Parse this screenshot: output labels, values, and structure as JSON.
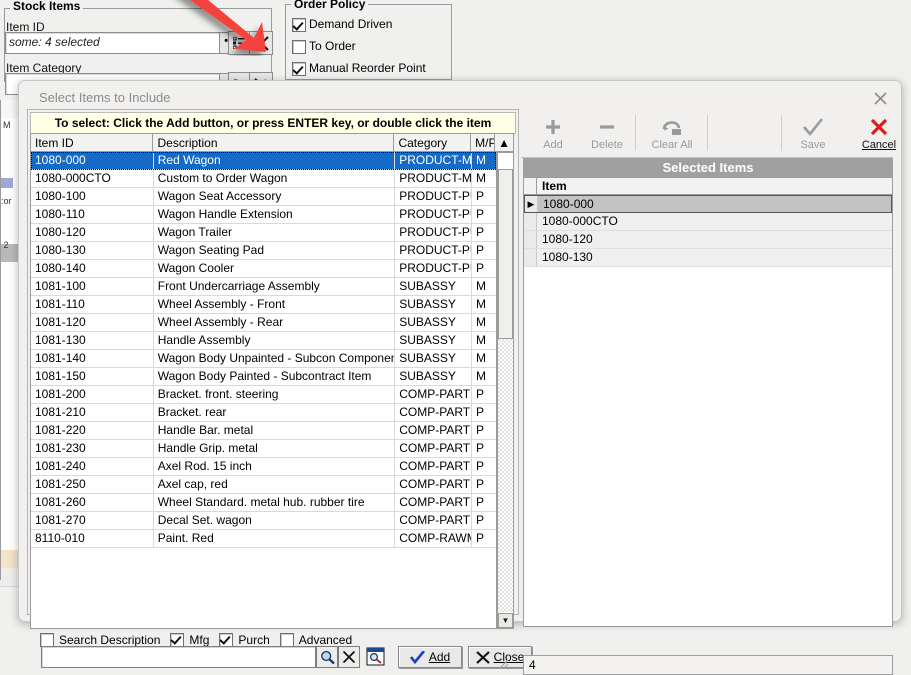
{
  "background": {
    "stock_items_group": "Stock Items",
    "item_id_label": "Item ID",
    "item_id_value": "some: 4 selected",
    "item_category_label": "Item Category",
    "order_policy_group": "Order Policy",
    "order_policy_options": [
      {
        "label": "Demand Driven",
        "checked": true
      },
      {
        "label": "To Order",
        "checked": false
      },
      {
        "label": "Manual Reorder Point",
        "checked": true
      }
    ],
    "lookup_icon": "list-lookup-icon",
    "clear_icon": "clear-x-icon",
    "ellipsis_icon": "ellipsis-icon"
  },
  "dialog": {
    "title": "Select Items to Include",
    "close_icon": "close-icon",
    "hint": "To select: Click the Add button, or press ENTER key, or double click the item",
    "grid": {
      "columns": [
        "Item ID",
        "Description",
        "Category",
        "M/P"
      ],
      "rows": [
        {
          "id": "1080-000",
          "desc": "Red Wagon",
          "cat": "PRODUCT-MFG",
          "mp": "M",
          "selected": true
        },
        {
          "id": "1080-000CTO",
          "desc": "Custom to Order Wagon",
          "cat": "PRODUCT-MFG",
          "mp": "M",
          "selected": false
        },
        {
          "id": "1080-100",
          "desc": "Wagon Seat Accessory",
          "cat": "PRODUCT-PURC",
          "mp": "P",
          "selected": false
        },
        {
          "id": "1080-110",
          "desc": "Wagon Handle Extension",
          "cat": "PRODUCT-PURC",
          "mp": "P",
          "selected": false
        },
        {
          "id": "1080-120",
          "desc": "Wagon Trailer",
          "cat": "PRODUCT-PURC",
          "mp": "P",
          "selected": false
        },
        {
          "id": "1080-130",
          "desc": "Wagon Seating Pad",
          "cat": "PRODUCT-PURC",
          "mp": "P",
          "selected": false
        },
        {
          "id": "1080-140",
          "desc": "Wagon Cooler",
          "cat": "PRODUCT-PURC",
          "mp": "P",
          "selected": false
        },
        {
          "id": "1081-100",
          "desc": "Front Undercarriage Assembly",
          "cat": "SUBASSY",
          "mp": "M",
          "selected": false
        },
        {
          "id": "1081-110",
          "desc": "Wheel Assembly - Front",
          "cat": "SUBASSY",
          "mp": "M",
          "selected": false
        },
        {
          "id": "1081-120",
          "desc": "Wheel Assembly - Rear",
          "cat": "SUBASSY",
          "mp": "M",
          "selected": false
        },
        {
          "id": "1081-130",
          "desc": "Handle Assembly",
          "cat": "SUBASSY",
          "mp": "M",
          "selected": false
        },
        {
          "id": "1081-140",
          "desc": "Wagon Body Unpainted - Subcon Component",
          "cat": "SUBASSY",
          "mp": "M",
          "selected": false
        },
        {
          "id": "1081-150",
          "desc": "Wagon Body Painted -  Subcontract Item",
          "cat": "SUBASSY",
          "mp": "M",
          "selected": false
        },
        {
          "id": "1081-200",
          "desc": "Bracket. front. steering",
          "cat": "COMP-PART",
          "mp": "P",
          "selected": false
        },
        {
          "id": "1081-210",
          "desc": "Bracket. rear",
          "cat": "COMP-PART",
          "mp": "P",
          "selected": false
        },
        {
          "id": "1081-220",
          "desc": "Handle Bar. metal",
          "cat": "COMP-PART",
          "mp": "P",
          "selected": false
        },
        {
          "id": "1081-230",
          "desc": "Handle Grip. metal",
          "cat": "COMP-PART",
          "mp": "P",
          "selected": false
        },
        {
          "id": "1081-240",
          "desc": "Axel Rod. 15 inch",
          "cat": "COMP-PART",
          "mp": "P",
          "selected": false
        },
        {
          "id": "1081-250",
          "desc": "Axel cap, red",
          "cat": "COMP-PART",
          "mp": "P",
          "selected": false
        },
        {
          "id": "1081-260",
          "desc": "Wheel Standard. metal hub. rubber tire",
          "cat": "COMP-PART",
          "mp": "P",
          "selected": false
        },
        {
          "id": "1081-270",
          "desc": "Decal Set. wagon",
          "cat": "COMP-PART",
          "mp": "P",
          "selected": false
        },
        {
          "id": "8110-010",
          "desc": "Paint. Red",
          "cat": "COMP-RAWMAT",
          "mp": "P",
          "selected": false
        }
      ]
    },
    "filters": [
      {
        "label": "Search Description",
        "checked": false
      },
      {
        "label": "Mfg",
        "checked": true
      },
      {
        "label": "Purch",
        "checked": true
      },
      {
        "label": "Advanced",
        "checked": false
      }
    ],
    "search": {
      "value": "",
      "placeholder": "",
      "find_icon": "magnifier-icon",
      "clear_icon": "clear-x-icon",
      "advanced_find_icon": "advanced-search-icon"
    },
    "buttons": {
      "add": "Add",
      "close": "Close",
      "add_icon": "check-icon",
      "close_icon": "x-icon"
    },
    "toolbar": [
      {
        "label": "Add",
        "icon": "plus-icon",
        "enabled": false
      },
      {
        "label": "Delete",
        "icon": "minus-icon",
        "enabled": false
      },
      {
        "label": "Clear All",
        "icon": "eraser-icon",
        "enabled": false
      },
      {
        "label": "Save",
        "icon": "check-icon",
        "enabled": false
      },
      {
        "label": "Cancel",
        "icon": "red-x-icon",
        "enabled": true
      }
    ],
    "selected_panel": {
      "header": "Selected Items",
      "column": "Item",
      "rows": [
        {
          "item": "1080-000",
          "current": true
        },
        {
          "item": "1080-000CTO",
          "current": false
        },
        {
          "item": "1080-120",
          "current": false
        },
        {
          "item": "1080-130",
          "current": false
        }
      ],
      "count": "4"
    }
  },
  "annotation": {
    "arrow_color": "#f4433d",
    "arrow_name": "red-arrow-annotation"
  }
}
